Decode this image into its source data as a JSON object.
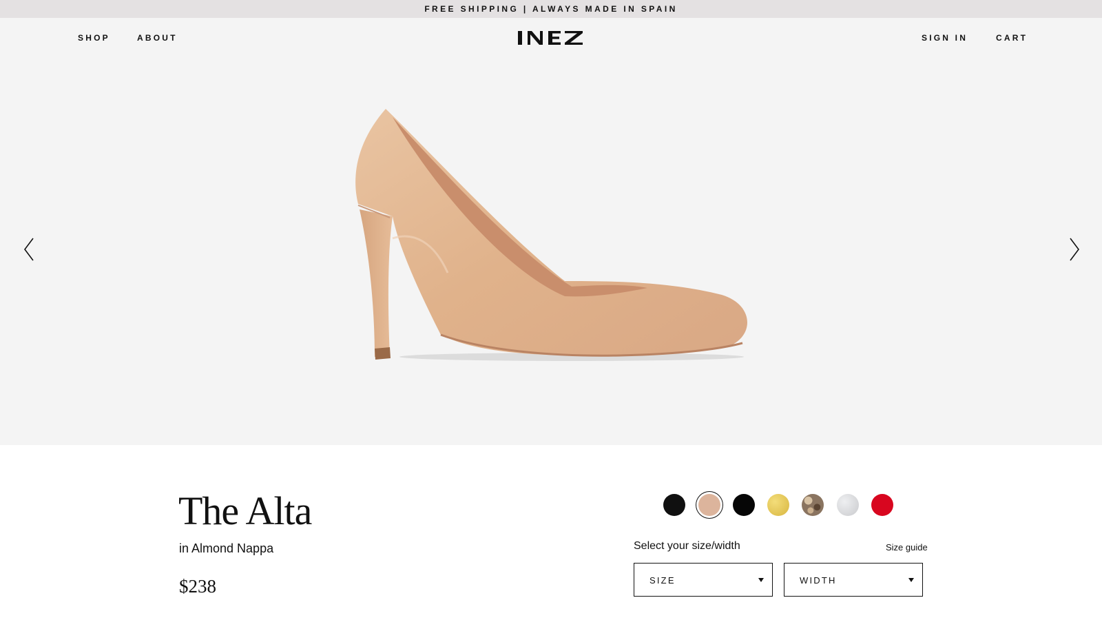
{
  "promo": {
    "text": "FREE SHIPPING | ALWAYS MADE IN SPAIN"
  },
  "nav": {
    "left": [
      "SHOP",
      "ABOUT"
    ],
    "right": [
      "SIGN IN",
      "CART"
    ],
    "logo": "INEZ"
  },
  "carousel": {
    "prev_icon": "chevron-left-icon",
    "next_icon": "chevron-right-icon"
  },
  "product": {
    "name": "The Alta",
    "variant": "in Almond Nappa",
    "price": "$238",
    "swatches": [
      {
        "name": "black-nappa",
        "color": "#101010",
        "selected": false
      },
      {
        "name": "almond-nappa",
        "color": "#dcb49c",
        "selected": true
      },
      {
        "name": "black",
        "color": "#060606",
        "selected": false
      },
      {
        "name": "gold",
        "color": "#d8b640",
        "selected": false
      },
      {
        "name": "snake",
        "color": "#8a7460",
        "selected": false
      },
      {
        "name": "silver",
        "color": "#c9cacd",
        "selected": false
      },
      {
        "name": "red",
        "color": "#d8061f",
        "selected": false
      }
    ],
    "size_prompt": "Select your size/width",
    "size_guide": "Size guide",
    "size_select": "SIZE",
    "width_select": "WIDTH"
  },
  "colors": {
    "hero_bg": "#f4f4f4",
    "promo_bg": "#e4e1e2",
    "shoe": "#e3b892"
  }
}
